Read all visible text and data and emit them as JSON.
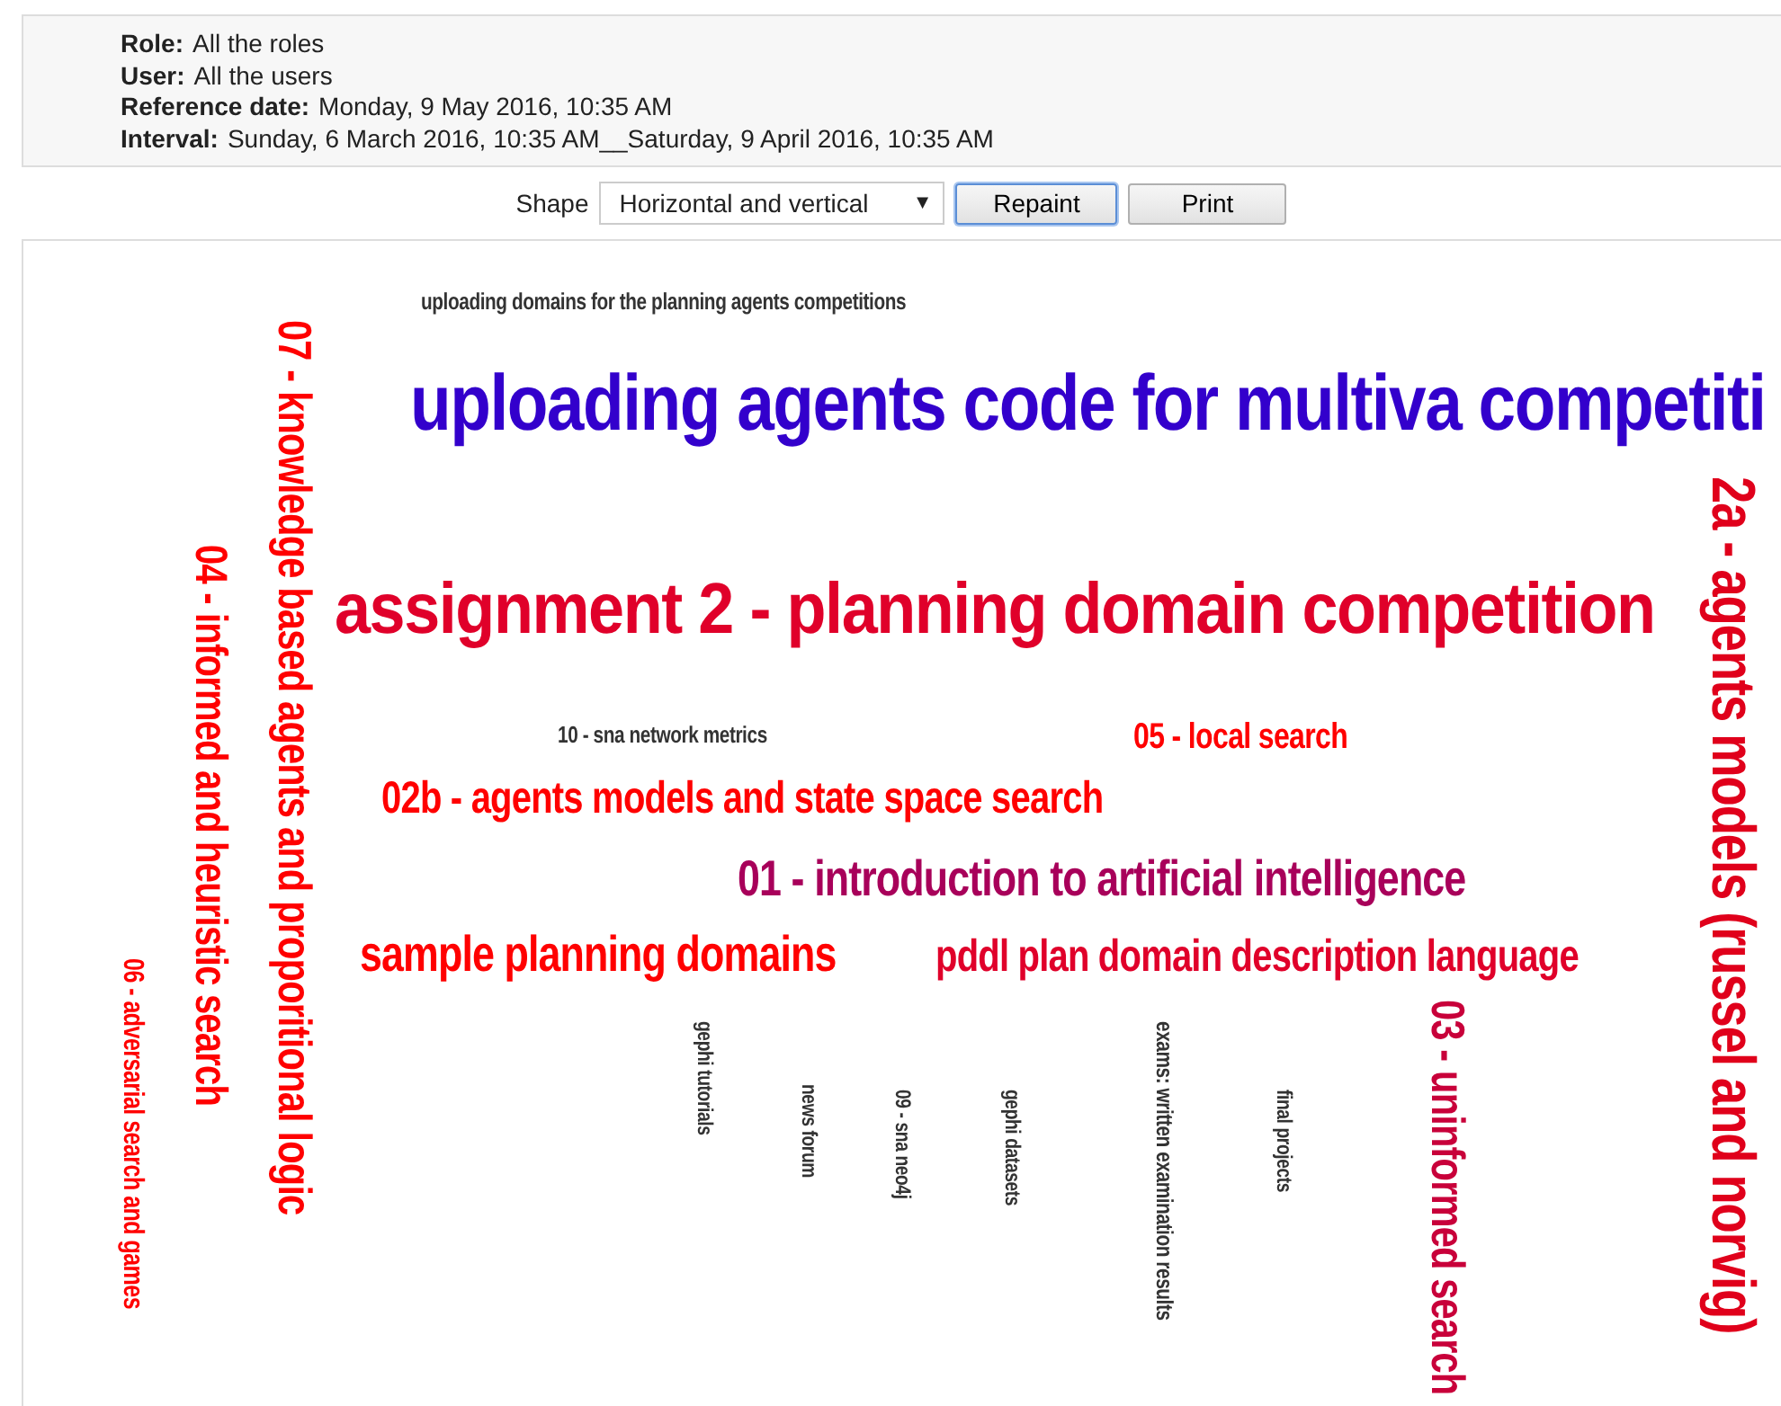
{
  "filters": [
    {
      "label": "Role:",
      "value": "All the roles"
    },
    {
      "label": "User:",
      "value": "All the users"
    },
    {
      "label": "Reference date:",
      "value": "Monday, 9 May 2016, 10:35 AM"
    },
    {
      "label": "Interval:",
      "value": "Sunday, 6 March 2016, 10:35 AM__Saturday, 9 April 2016, 10:35 AM"
    }
  ],
  "toolbar": {
    "shape_label": "Shape",
    "shape_value": "Horizontal and vertical",
    "caret": "▼",
    "buttons": [
      {
        "label": "Repaint",
        "focused": true
      },
      {
        "label": "Print",
        "focused": false
      }
    ]
  },
  "word_cloud": [
    {
      "text": "uploading domains for the planning agents competitions",
      "kind": "horizontal",
      "color": "#333333"
    },
    {
      "text": "2a - agents models (russel and norvig)",
      "kind": "vertical",
      "color": "#e0001b"
    },
    {
      "text": "uploading agents code for multiva competiti",
      "kind": "horizontal",
      "color": "#3300cc"
    },
    {
      "text": "exams: written examination results",
      "kind": "vertical",
      "color": "#333333"
    },
    {
      "text": "03 - uninformed search",
      "kind": "vertical",
      "color": "#c8003a"
    },
    {
      "text": "07 - knowledge based agents and proporitional logic",
      "kind": "vertical",
      "color": "#ff0000"
    },
    {
      "text": "assignment 2 - planning domain competition",
      "kind": "horizontal",
      "color": "#e0002a"
    },
    {
      "text": "04 - informed and heuristic search",
      "kind": "vertical",
      "color": "#ff0000"
    },
    {
      "text": "10 - sna network metrics",
      "kind": "horizontal",
      "color": "#333333"
    },
    {
      "text": "05 - local search",
      "kind": "horizontal",
      "color": "#ff0000"
    },
    {
      "text": "02b - agents models and state space search",
      "kind": "horizontal",
      "color": "#ff0000"
    },
    {
      "text": "01 - introduction to artificial intelligence",
      "kind": "horizontal",
      "color": "#a8005a"
    },
    {
      "text": "sample planning domains",
      "kind": "horizontal",
      "color": "#ff0000"
    },
    {
      "text": "pddl plan domain description language",
      "kind": "horizontal",
      "color": "#e0002a"
    },
    {
      "text": "06 - adversarial search and games",
      "kind": "vertical",
      "color": "#ff0000"
    },
    {
      "text": "gephi tutorials",
      "kind": "vertical",
      "color": "#333333"
    },
    {
      "text": "news forum",
      "kind": "vertical",
      "color": "#333333"
    },
    {
      "text": "09 - sna neo4j",
      "kind": "vertical",
      "color": "#333333"
    },
    {
      "text": "gephi datasets",
      "kind": "vertical",
      "color": "#333333"
    },
    {
      "text": "final projects",
      "kind": "vertical",
      "color": "#333333"
    }
  ]
}
